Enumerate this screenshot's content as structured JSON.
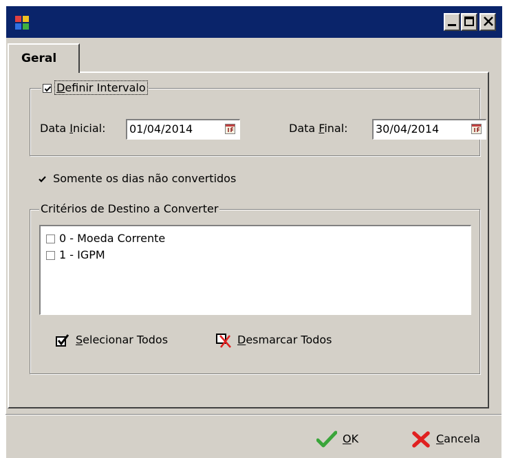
{
  "window": {
    "title": ""
  },
  "tabs": [
    {
      "label": "Geral"
    }
  ],
  "intervalo": {
    "label_pre": "",
    "label_key": "D",
    "label_rest": "efinir Intervalo",
    "checked": true,
    "data_inicial": {
      "label_pre": "Data ",
      "label_key": "I",
      "label_rest": "nicial:",
      "value": "01/04/2014"
    },
    "data_final": {
      "label_pre": "Data ",
      "label_key": "F",
      "label_rest": "inal:",
      "value": "30/04/2014"
    }
  },
  "somente": {
    "label": "Somente os dias não convertidos",
    "checked": true
  },
  "criterios": {
    "legend": "Critérios de Destino a Converter",
    "items": [
      {
        "label": "0 - Moeda Corrente",
        "checked": false
      },
      {
        "label": "1 - IGPM",
        "checked": false
      }
    ],
    "selecionar": {
      "key": "S",
      "rest": "elecionar Todos"
    },
    "desmarcar": {
      "key": "D",
      "rest": "esmarcar Todos"
    }
  },
  "footer": {
    "ok": {
      "key": "O",
      "rest": "K"
    },
    "cancela": {
      "key": "C",
      "rest": "ancela"
    }
  },
  "icons": {
    "ok": "green-checkmark-icon",
    "cancel": "red-x-icon",
    "select_all": "checkbox-check-icon",
    "deselect_all": "checkbox-x-icon",
    "calendar": "calendar-icon"
  },
  "colors": {
    "titlebar": "#0a246a",
    "face": "#d4d0c8",
    "ok_green": "#3aa53a",
    "cancel_red": "#e02020"
  }
}
